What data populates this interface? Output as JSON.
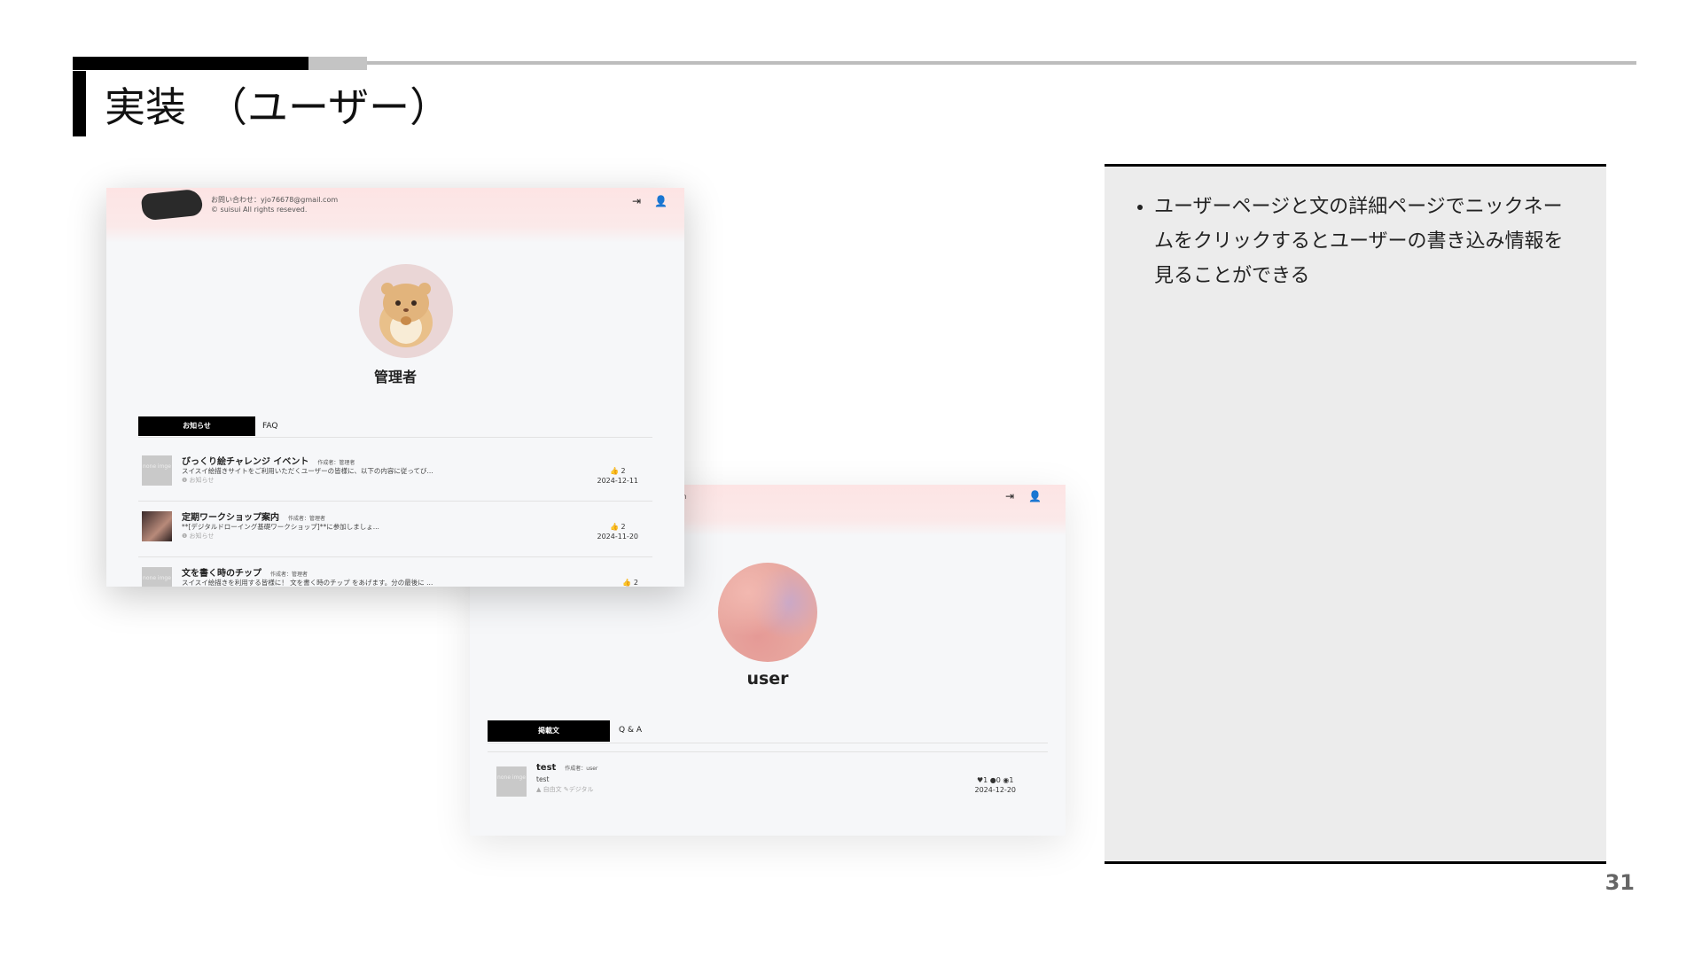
{
  "slide": {
    "title": "実装　（ユーザー）",
    "page_number": "31",
    "bullets": [
      "ユーザーページと文の詳細ページでニックネームをクリックするとユーザーの書き込み情報を見ることができる"
    ]
  },
  "screenshot_admin": {
    "contact_line1": "お問い合わせ：yjo76678@gmail.com",
    "contact_line2": "© suisui All rights reseved.",
    "logout_icon": "logout-icon",
    "user_icon": "user-icon",
    "username": "管理者",
    "tabs": [
      "お知らせ",
      "FAQ"
    ],
    "posts": [
      {
        "title": "びっくり絵チャレンジ イベント",
        "author": "作成者：管理者",
        "body": "スイスイ絵描きサイトをご利用いただくユーザーの皆様に、以下の内容に従ってび...",
        "category": "❶ お知らせ",
        "likes": "👍 2",
        "date": "2024-12-11",
        "thumb": "none imge"
      },
      {
        "title": "定期ワークショップ案内",
        "author": "作成者：管理者",
        "body": "**[デジタルドローイング基礎ワークショップ]**に参加しましょ...",
        "category": "❶ お知らせ",
        "likes": "👍 2",
        "date": "2024-11-20",
        "thumb": ""
      },
      {
        "title": "文を書く時のチップ",
        "author": "作成者：管理者",
        "body": "スイスイ絵描きを利用する皆様に！ 文を書く時のチップ をあげます。分の最後に ...",
        "category": "",
        "likes": "👍 2",
        "date": "",
        "thumb": "none imge"
      }
    ]
  },
  "screenshot_user": {
    "contact_fragment": "om",
    "username": "user",
    "tabs": [
      "掲載文",
      "Q & A"
    ],
    "posts": [
      {
        "title": "test",
        "author": "作成者：user",
        "body": "test",
        "category": "▲ 自由文 ✎デジタル",
        "stats": "♥1  ●0  ◉1",
        "date": "2024-12-20",
        "thumb": "none imge"
      }
    ]
  }
}
